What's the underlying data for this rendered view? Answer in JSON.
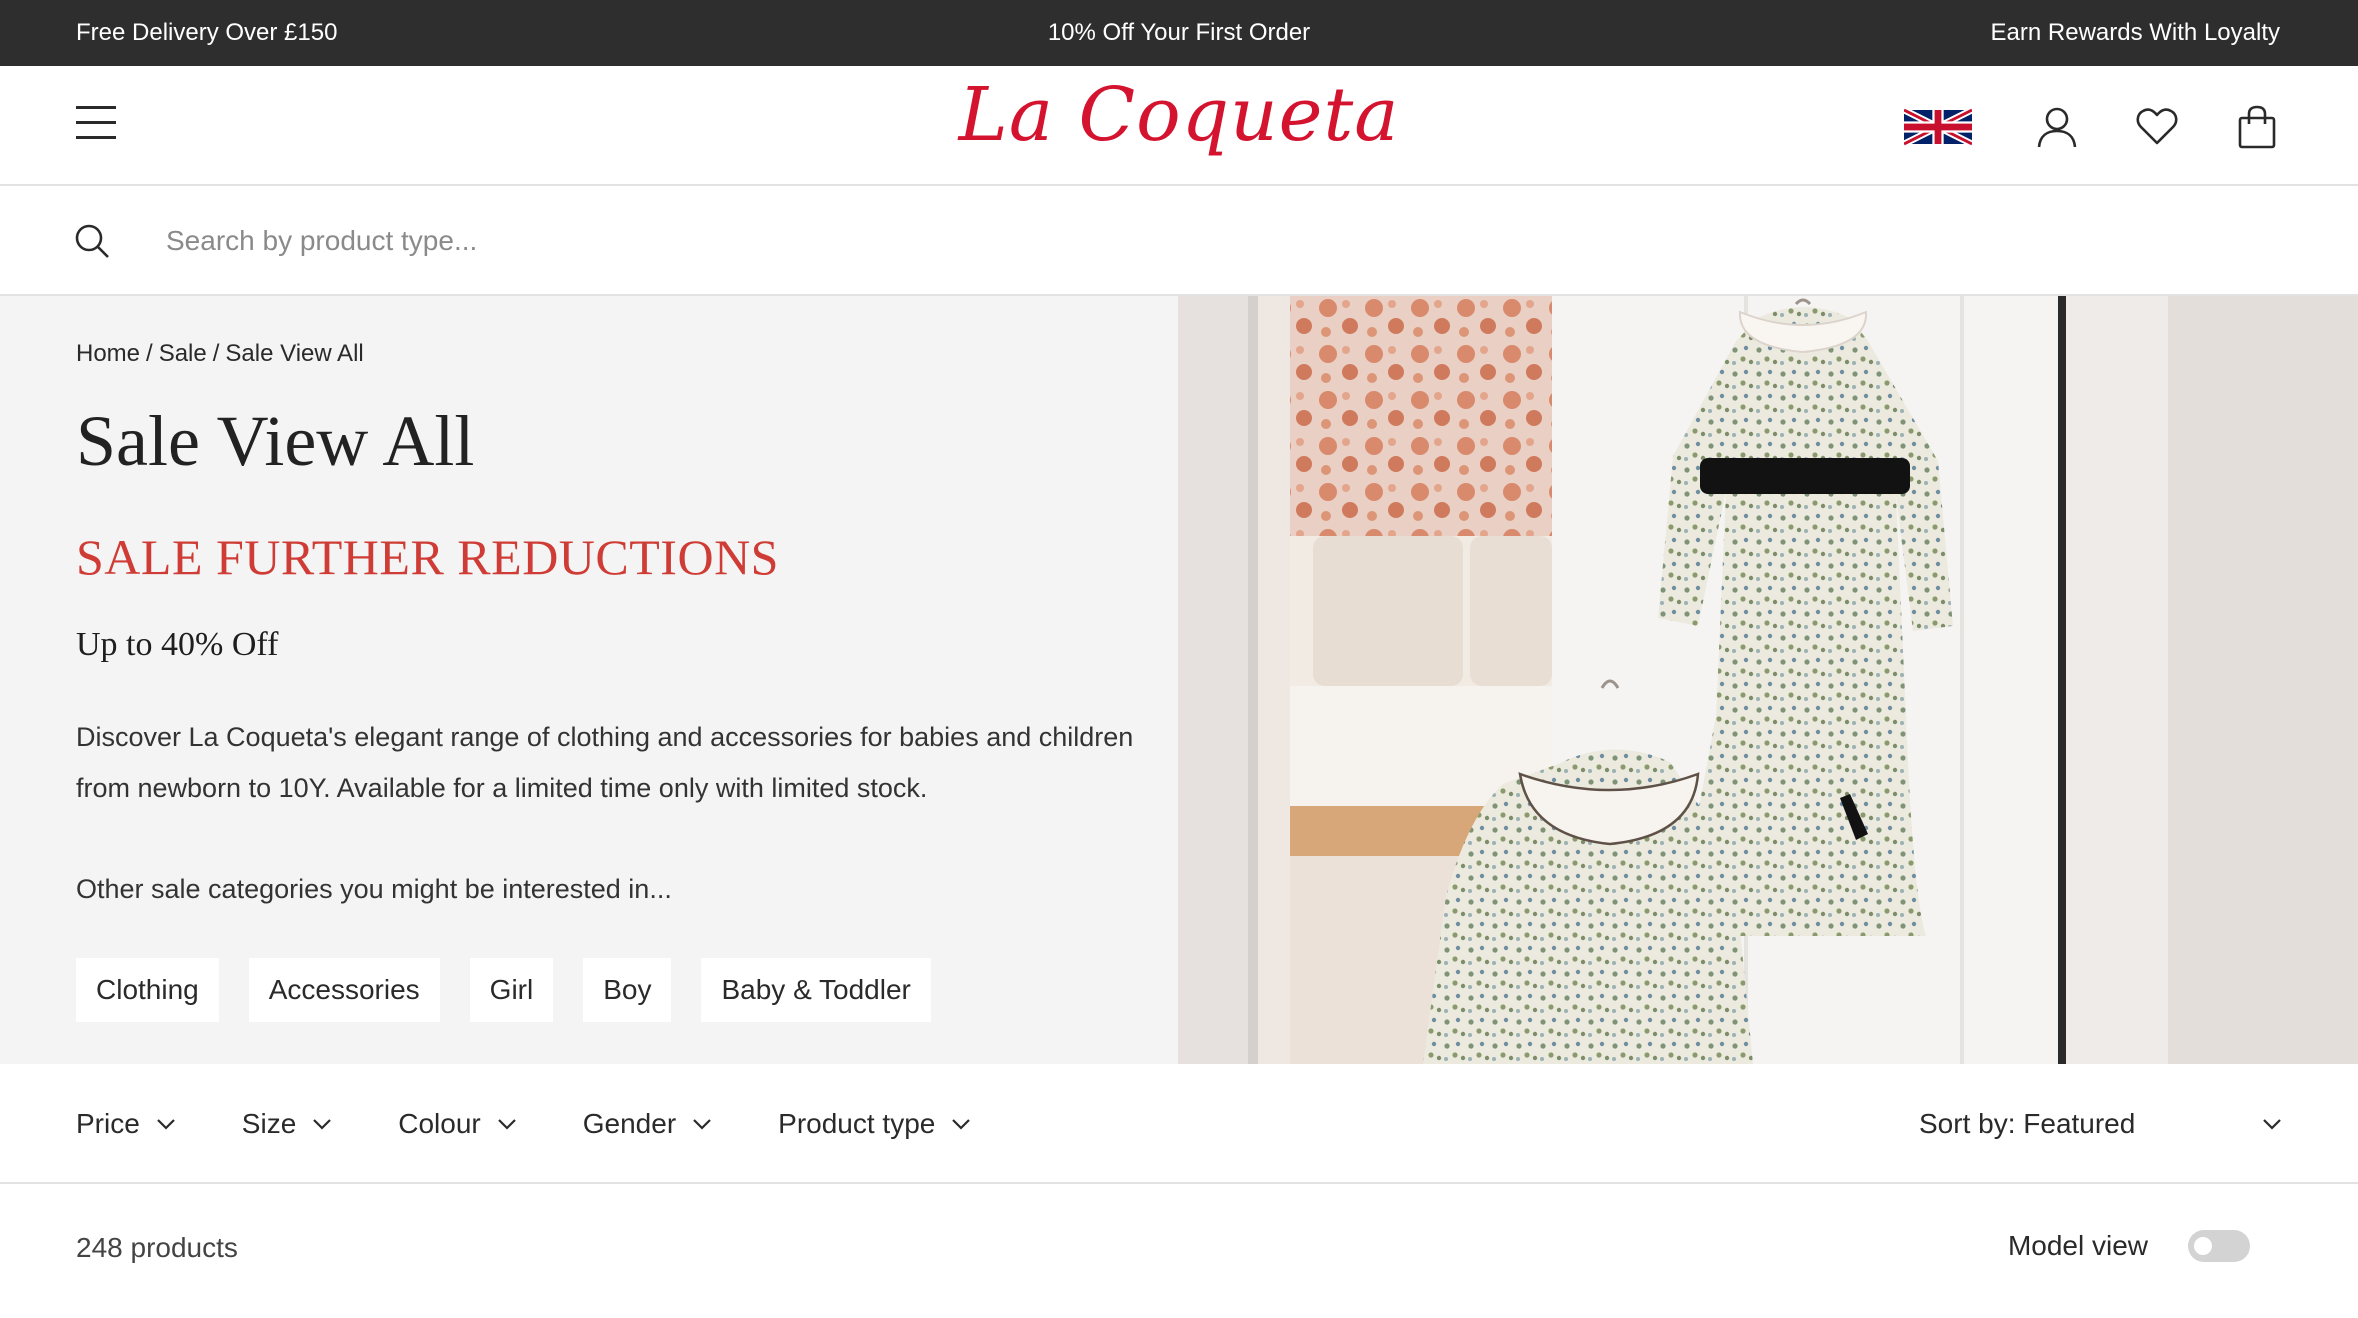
{
  "announcement": {
    "left": "Free Delivery Over £150",
    "center": "10% Off Your First Order",
    "right": "Earn Rewards With Loyalty"
  },
  "header": {
    "logo": "La Coqueta",
    "icons": [
      "menu-icon",
      "uk-flag-icon",
      "account-icon",
      "heart-icon",
      "bag-icon"
    ],
    "brand_color": "#d4132f"
  },
  "search": {
    "placeholder": "Search by product type...",
    "value": ""
  },
  "hero": {
    "breadcrumb": [
      "Home",
      "Sale",
      "Sale View All"
    ],
    "breadcrumb_separator": "/",
    "title": "Sale View All",
    "sale_heading": "SALE FURTHER REDUCTIONS",
    "sale_subheading": "Up to 40% Off",
    "description": "Discover La Coqueta's elegant range of clothing and accessories for babies and children from newborn to 10Y. Available for a limited time only with limited stock.",
    "other_categories_text": "Other sale categories you might be interested in...",
    "categories": [
      "Clothing",
      "Accessories",
      "Girl",
      "Boy",
      "Baby & Toddler"
    ],
    "sale_color": "#cf3c35"
  },
  "filters": {
    "items": [
      "Price",
      "Size",
      "Colour",
      "Gender",
      "Product type"
    ],
    "sort_label": "Sort by: Featured"
  },
  "products": {
    "count_label": "248 products",
    "model_view_label": "Model view",
    "model_view_enabled": false
  }
}
